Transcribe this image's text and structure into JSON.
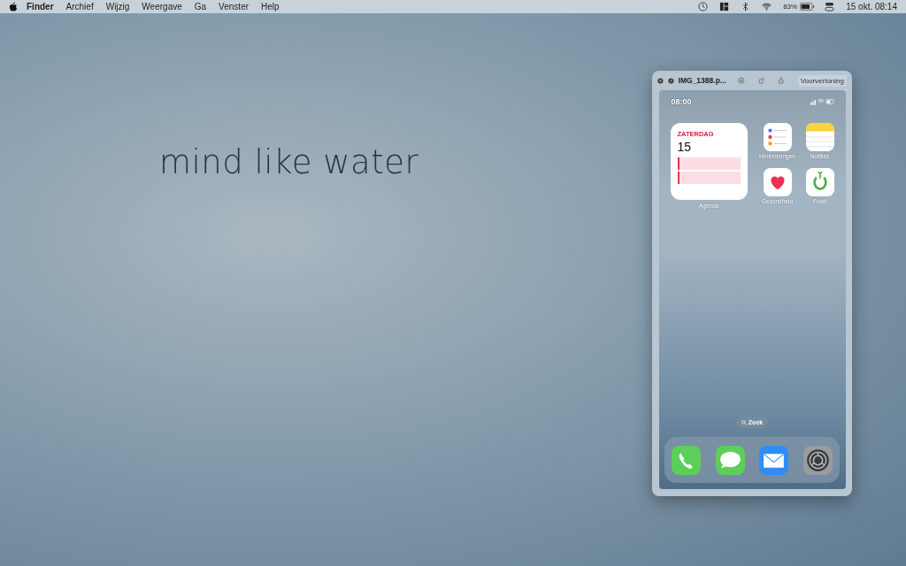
{
  "menu_bar": {
    "app_menu": "Finder",
    "menus": [
      "Archief",
      "Wijzig",
      "Weergave",
      "Ga",
      "Venster",
      "Help"
    ],
    "battery": "83%",
    "clock": "15 okt.  08:14"
  },
  "desktop": {
    "wallpaper_text": "mind like water"
  },
  "preview_window": {
    "title": "IMG_1388.p...",
    "app_label": "Voorvertoning",
    "phone": {
      "time": "08:00",
      "calendar_widget": {
        "day": "ZATERDAG",
        "date": "15",
        "events": [
          {
            "color": "#e8334a"
          },
          {
            "color": "#e8334a"
          }
        ],
        "label": "Agenda"
      },
      "apps": [
        {
          "kind": "reminders",
          "label": "Herinneringen"
        },
        {
          "kind": "notes",
          "label": "Notities"
        },
        {
          "kind": "health",
          "label": "Gezondheid"
        },
        {
          "kind": "food",
          "label": "Food"
        }
      ],
      "search": "Zoek",
      "dock": [
        {
          "kind": "phone"
        },
        {
          "kind": "messages"
        },
        {
          "kind": "mail"
        },
        {
          "kind": "settings"
        }
      ]
    }
  }
}
